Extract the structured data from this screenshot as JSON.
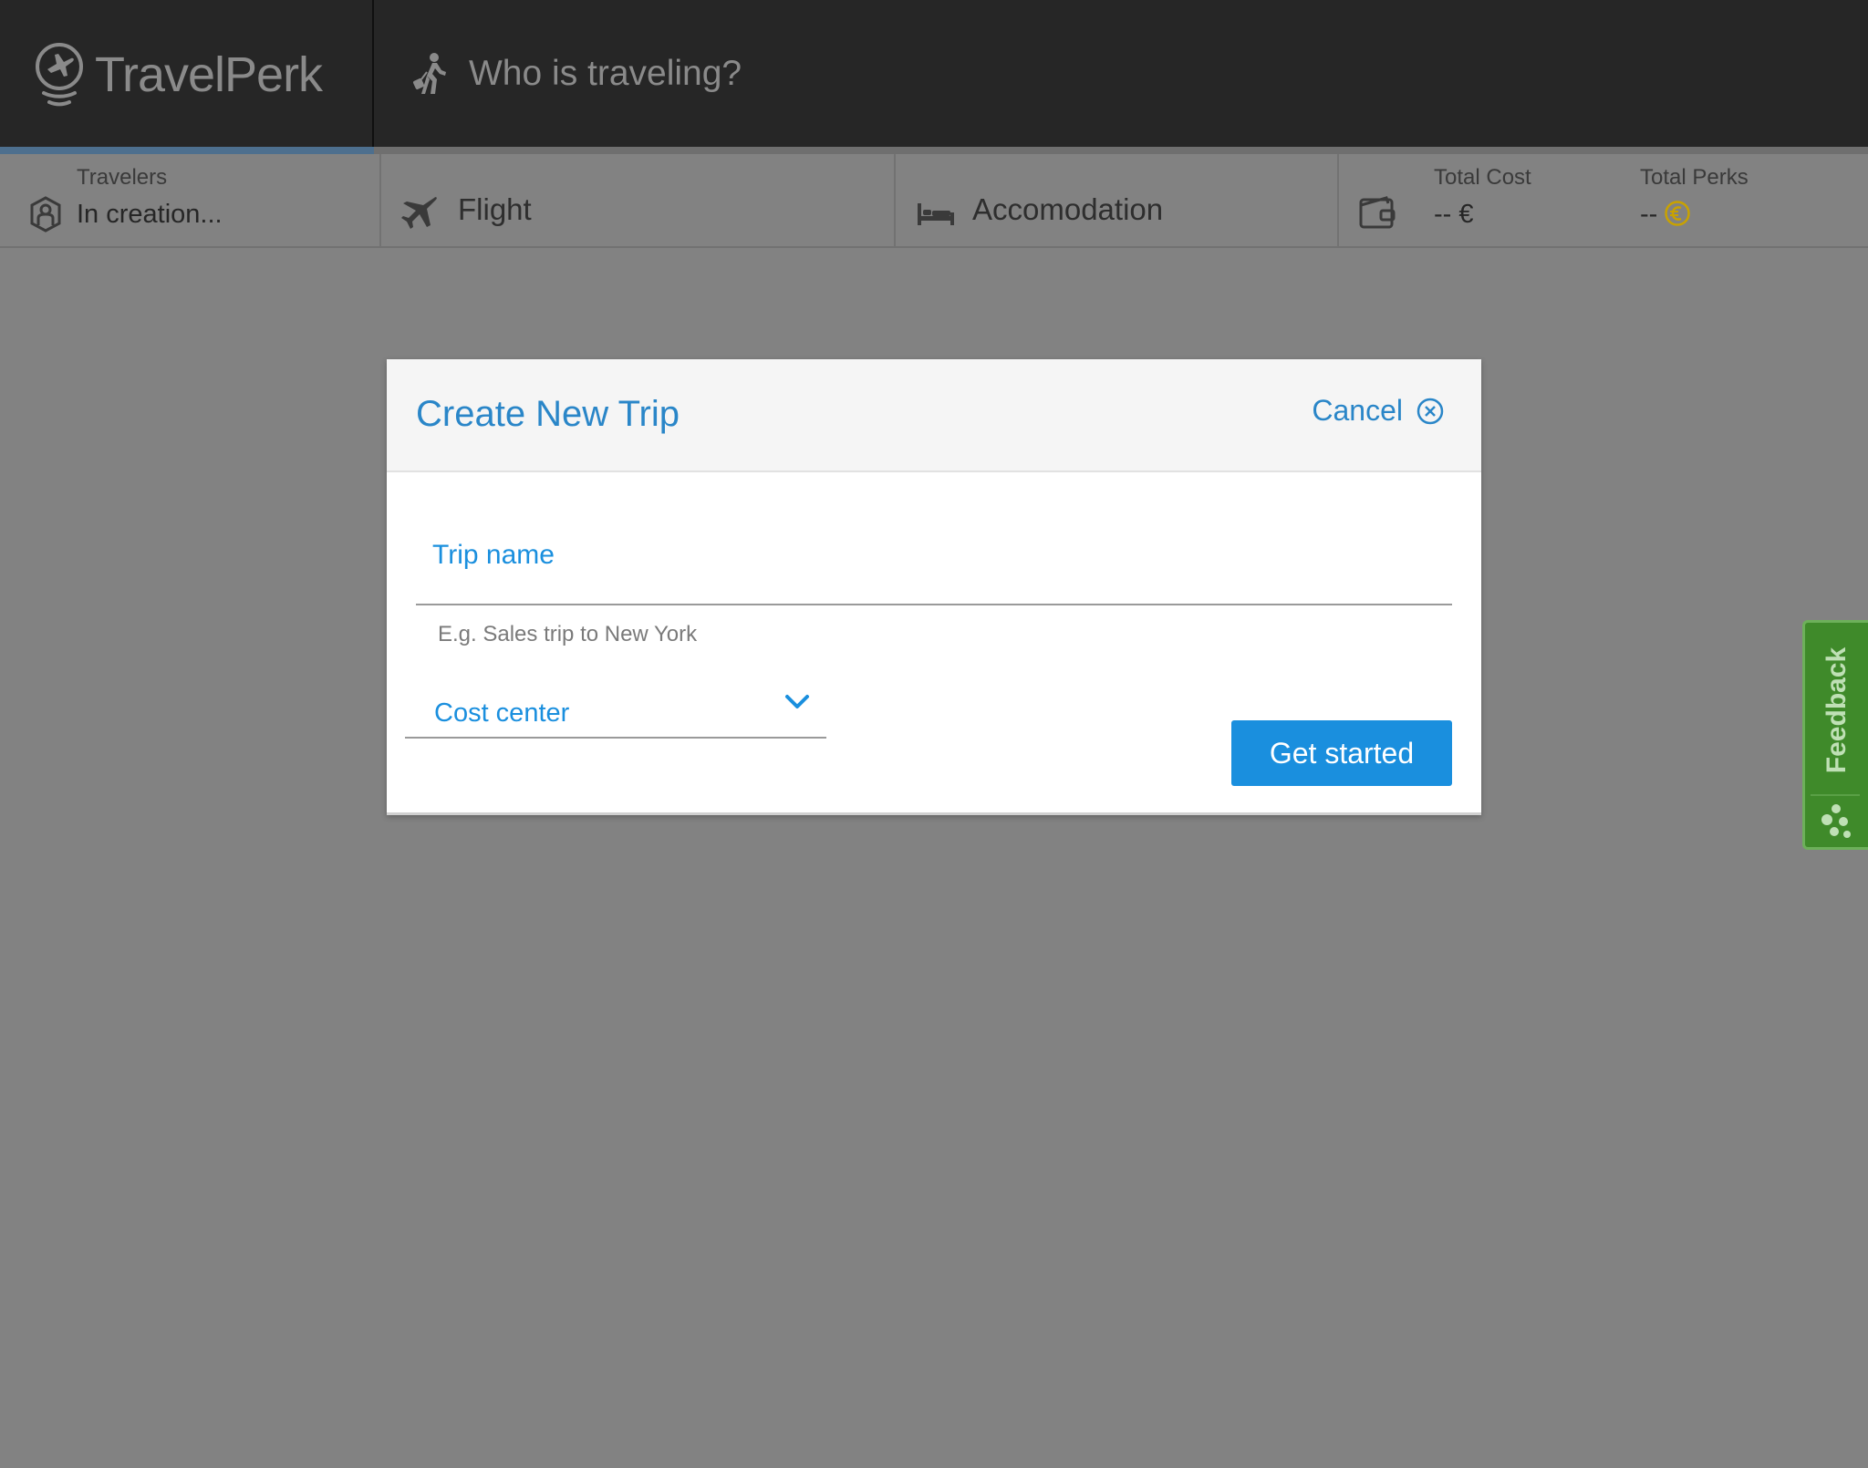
{
  "header": {
    "logo_text": "TravelPerk",
    "step_title": "Who is traveling?",
    "step_icon": "walking-traveler-icon"
  },
  "progress": {
    "fraction": 0.2,
    "fill_color": "#4d6f8e"
  },
  "summary": {
    "travelers": {
      "label": "Travelers",
      "value": "In creation...",
      "icon": "traveler-shield-icon"
    },
    "flight": {
      "label": "Flight",
      "icon": "airplane-icon"
    },
    "accommodation": {
      "label": "Accomodation",
      "icon": "bed-icon"
    },
    "total_cost": {
      "label": "Total Cost",
      "value": "-- €",
      "icon": "wallet-icon"
    },
    "total_perks": {
      "label": "Total Perks",
      "value": "--",
      "icon": "euro-coin-icon"
    }
  },
  "modal": {
    "title": "Create New Trip",
    "cancel_label": "Cancel",
    "trip_name_label": "Trip name",
    "trip_name_hint": "E.g. Sales trip to New York",
    "cost_center_label": "Cost center",
    "submit_label": "Get started"
  },
  "feedback": {
    "label": "Feedback"
  },
  "colors": {
    "accent": "#1a8fde",
    "header_bg": "#262626",
    "overlay": "#828282",
    "feedback_green": "#3f8a2a",
    "coin_gold": "#c9a200"
  }
}
